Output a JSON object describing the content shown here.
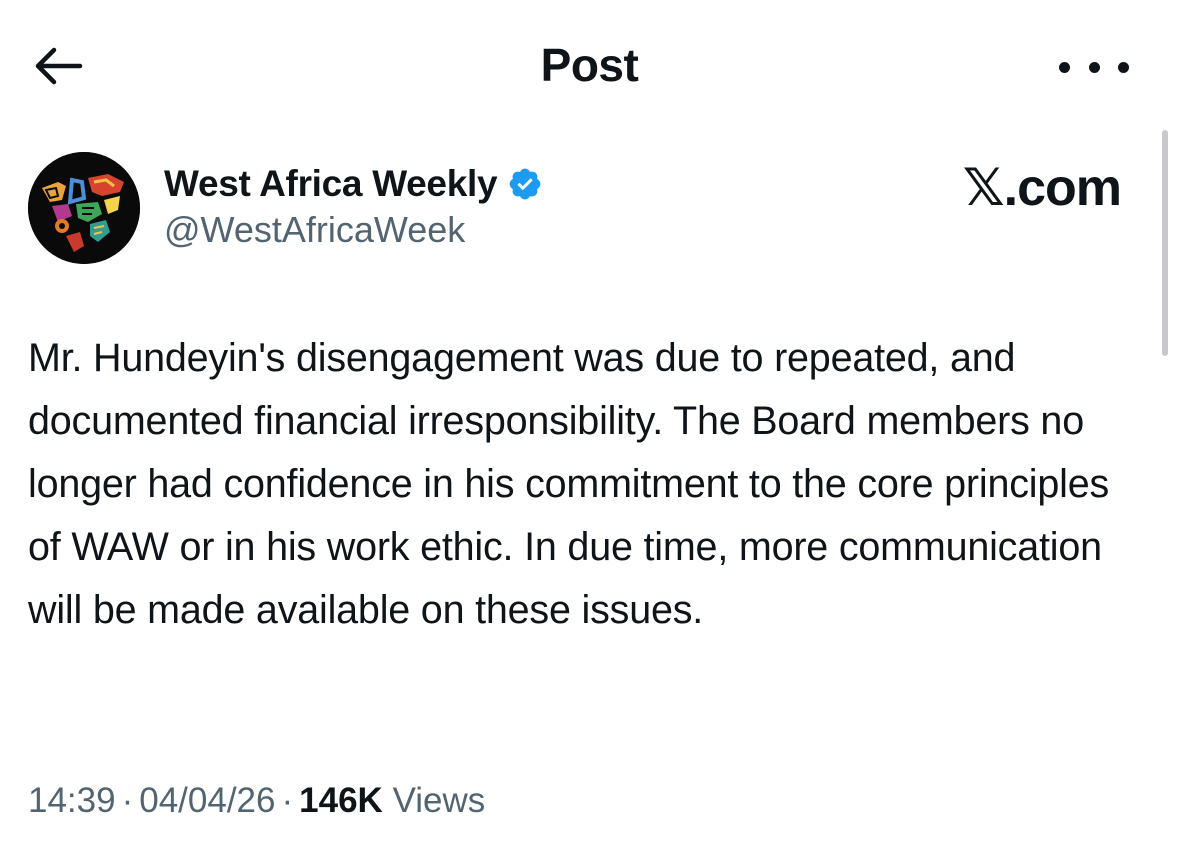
{
  "header": {
    "title": "Post",
    "back_icon": "arrow-left-icon",
    "more_icon": "more-horizontal-icon"
  },
  "author": {
    "name": "West Africa Weekly",
    "handle": "@WestAfricaWeek",
    "verified": true,
    "verified_color": "#1d9bf0"
  },
  "brand": {
    "label": "𝕏.com"
  },
  "post": {
    "text": "Mr. Hundeyin's disengagement was due to repeated, and documented financial irresponsibility. The Board members no longer had confidence in his commitment to the core principles of WAW or in his work ethic. In due time, more communication will be made available on these issues."
  },
  "meta": {
    "time": "14:39",
    "date": "04/04/26",
    "separator": "·",
    "views_count": "146K",
    "views_label": "Views"
  }
}
